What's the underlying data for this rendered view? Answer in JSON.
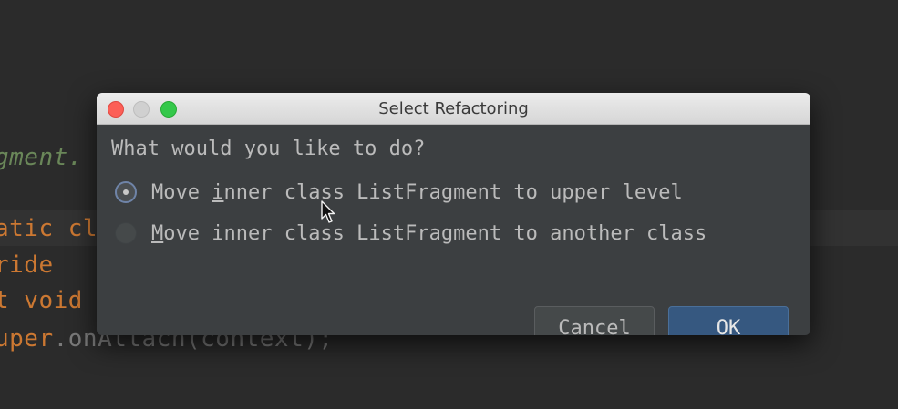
{
  "background_code": {
    "line1": "gment.",
    "line2_kw": "atic cl",
    "line3_kw": "ride",
    "line4_kw": "t void",
    "line5_kw": "uper",
    "line5_rest": ".onAttach(context);"
  },
  "dialog": {
    "title": "Select Refactoring",
    "question": "What would you like to do?",
    "options": [
      {
        "prefix": "Move ",
        "mnemonic": "i",
        "suffix": "nner class ListFragment to upper level",
        "selected": true
      },
      {
        "prefix": "",
        "mnemonic": "M",
        "suffix": "ove inner class ListFragment to another class",
        "selected": false
      }
    ],
    "buttons": {
      "cancel": "Cancel",
      "ok": "OK"
    }
  },
  "colors": {
    "editor_bg": "#2b2b2b",
    "dialog_bg": "#3c3f41",
    "ok_button": "#365880",
    "close_light": "#fc5f57",
    "max_light": "#34c84a"
  },
  "icons": [
    "close-light-icon",
    "minimize-light-icon",
    "maximize-light-icon",
    "radio-selected-icon",
    "radio-unselected-icon",
    "mouse-cursor-icon"
  ]
}
